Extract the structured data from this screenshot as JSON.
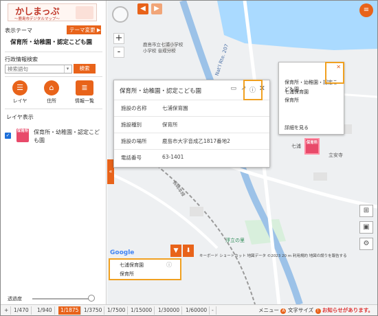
{
  "app": {
    "logo_title": "かしまっぷ",
    "logo_subtitle": "～鹿島市デジタルマップ～"
  },
  "sidebar": {
    "theme_label": "表示テーマ",
    "theme_change_button": "テーマ変更 ▶",
    "theme_name": "保育所・幼稚園・認定こども園",
    "admin_search_label": "行政情報検索",
    "search_placeholder": "検索語句",
    "search_button": "検索",
    "tools": [
      {
        "label": "レイヤ",
        "icon": "layers-icon"
      },
      {
        "label": "住所",
        "icon": "home-icon"
      },
      {
        "label": "情報一覧",
        "icon": "list-icon"
      }
    ],
    "layer_display_label": "レイヤ表示",
    "layer_item_label": "保育所・幼稚園・認定こども園",
    "layer_icon_text": "保育所",
    "opacity_label": "透過度",
    "opacity_value": 0.95
  },
  "scales": [
    "1/470",
    "1/940",
    "1/1875",
    "1/3750",
    "1/7500",
    "1/15000",
    "1/30000",
    "1/60000"
  ],
  "active_scale": "1/1875",
  "footer": {
    "plus": "+",
    "minus": "-",
    "menu": "メニュー",
    "text_size": "文字サイズ",
    "notice": "お知らせがあります。"
  },
  "map": {
    "route_label": "Nat'l Rte. 207",
    "school_label": "鹿島市立七浦小学校",
    "school_label_line2": "小学校 音成分校",
    "facility_label": "七浦",
    "facility_label2": "立安寺",
    "park_label": "浮立の里",
    "road_label": "長崎本線",
    "google": "Google",
    "attribution": "キーボード ショートカット   地図データ ©2023   20 m   利用規約   地図の誤りを報告する"
  },
  "popup": {
    "title": "保育所・幼稚園・認定こども園",
    "rows": [
      {
        "key": "施設の名称",
        "value": "七浦保育園"
      },
      {
        "key": "施設種別",
        "value": "保育所"
      },
      {
        "key": "施設の場所",
        "value": "鹿島市大字音成乙1817番地2"
      },
      {
        "key": "電話番号",
        "value": "63-1401"
      }
    ]
  },
  "small_popup": {
    "category": "保育所・幼稚園・認定こども園",
    "name": "七浦保育園",
    "type": "保育所",
    "detail_link": "詳細を見る"
  },
  "tooltip": {
    "name": "七浦保育園",
    "type": "保育所"
  }
}
